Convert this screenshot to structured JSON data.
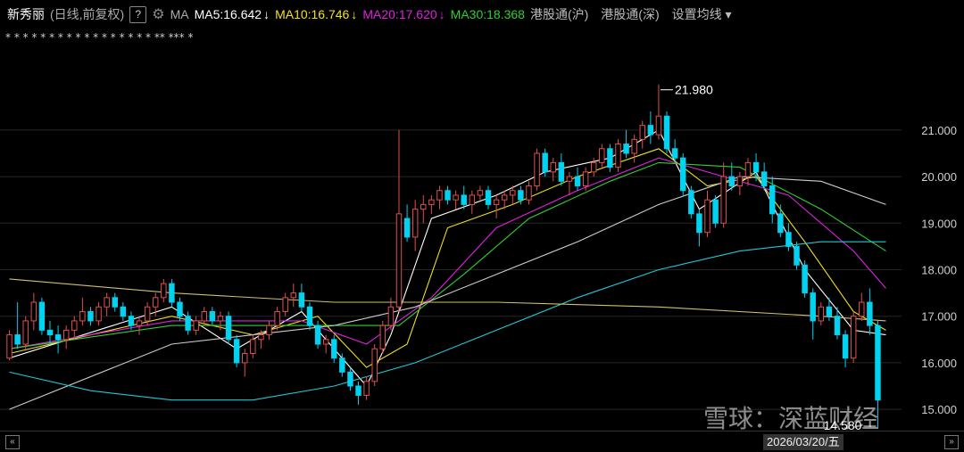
{
  "header": {
    "stock_name": "新秀丽",
    "adjust_mode": "(日线,前复权)",
    "help_label": "?",
    "ma_label": "MA",
    "ma5": "MA5:16.642",
    "ma10": "MA10:16.746",
    "ma20": "MA20:17.620",
    "ma30": "MA30:18.368",
    "hk_sh": "港股通(沪)",
    "hk_sz": "港股通(深)",
    "settings": "设置均线",
    "down_arrow": "↓",
    "settings_arrow": "▾"
  },
  "icons": {
    "gear": "gear-icon",
    "prev": "arrow-left-icon",
    "next": "arrow-right-icon",
    "watermark": "snowball-logo-icon"
  },
  "colors": {
    "up": "#e05050",
    "down": "#00d2f0",
    "ma5": "#ffffff",
    "ma10": "#f0e020",
    "ma20": "#e020e0",
    "ma30": "#30d030",
    "ma_long1": "#cccccc",
    "ma_long2": "#20c8d8",
    "ma_long3": "#d0c070"
  },
  "footer": {
    "date": "2026/03/20/五",
    "prev": "«",
    "next": "»"
  },
  "watermark": "雪球：深蓝财经",
  "chart_data": {
    "type": "candlestick",
    "ylim": [
      14.6,
      22.3
    ],
    "yticks": [
      "21.000",
      "20.000",
      "19.000",
      "18.000",
      "17.000",
      "16.000",
      "15.000"
    ],
    "high_label": "21.980",
    "low_label": "14.580",
    "marker_row": [
      "*",
      "*",
      "*",
      "*",
      "*",
      "* * *",
      "*",
      "*",
      "*",
      "*",
      "* *",
      "*",
      "*",
      "*",
      "**",
      "***",
      "*"
    ],
    "candles": [
      [
        16.1,
        16.7,
        16.05,
        16.6
      ],
      [
        16.6,
        17.3,
        16.3,
        16.4
      ],
      [
        16.4,
        17.0,
        16.3,
        16.9
      ],
      [
        16.9,
        17.5,
        16.7,
        17.3
      ],
      [
        17.3,
        17.4,
        16.6,
        16.7
      ],
      [
        16.7,
        16.9,
        16.4,
        16.6
      ],
      [
        16.6,
        16.8,
        16.2,
        16.5
      ],
      [
        16.5,
        16.8,
        16.3,
        16.7
      ],
      [
        16.7,
        17.0,
        16.5,
        16.9
      ],
      [
        16.9,
        17.4,
        16.8,
        17.1
      ],
      [
        17.1,
        17.2,
        16.8,
        16.9
      ],
      [
        16.9,
        17.3,
        16.8,
        17.2
      ],
      [
        17.2,
        17.5,
        17.0,
        17.4
      ],
      [
        17.4,
        17.5,
        17.1,
        17.2
      ],
      [
        17.2,
        17.3,
        16.9,
        17.0
      ],
      [
        17.0,
        17.1,
        16.7,
        16.8
      ],
      [
        16.8,
        17.0,
        16.6,
        16.9
      ],
      [
        16.9,
        17.3,
        16.8,
        17.2
      ],
      [
        17.2,
        17.5,
        17.0,
        17.4
      ],
      [
        17.4,
        17.8,
        17.3,
        17.7
      ],
      [
        17.7,
        17.8,
        17.2,
        17.3
      ],
      [
        17.3,
        17.4,
        16.9,
        17.0
      ],
      [
        17.0,
        17.1,
        16.6,
        16.7
      ],
      [
        16.7,
        17.0,
        16.6,
        16.9
      ],
      [
        16.9,
        17.2,
        16.8,
        17.1
      ],
      [
        17.1,
        17.2,
        16.8,
        16.9
      ],
      [
        16.9,
        17.1,
        16.7,
        17.0
      ],
      [
        17.0,
        17.1,
        16.4,
        16.5
      ],
      [
        16.5,
        16.6,
        15.9,
        16.0
      ],
      [
        16.0,
        16.3,
        15.7,
        16.2
      ],
      [
        16.2,
        16.6,
        16.1,
        16.5
      ],
      [
        16.5,
        16.7,
        16.3,
        16.6
      ],
      [
        16.6,
        16.9,
        16.5,
        16.8
      ],
      [
        16.8,
        17.2,
        16.7,
        17.1
      ],
      [
        17.1,
        17.5,
        17.0,
        17.4
      ],
      [
        17.4,
        17.7,
        17.2,
        17.5
      ],
      [
        17.5,
        17.7,
        17.1,
        17.2
      ],
      [
        17.2,
        17.3,
        16.7,
        16.8
      ],
      [
        16.8,
        16.9,
        16.3,
        16.4
      ],
      [
        16.4,
        16.6,
        16.2,
        16.5
      ],
      [
        16.5,
        16.6,
        16.0,
        16.1
      ],
      [
        16.1,
        16.2,
        15.7,
        15.8
      ],
      [
        15.8,
        15.9,
        15.4,
        15.5
      ],
      [
        15.5,
        15.6,
        15.1,
        15.3
      ],
      [
        15.3,
        15.7,
        15.2,
        15.6
      ],
      [
        15.6,
        16.4,
        15.5,
        16.3
      ],
      [
        16.3,
        16.9,
        16.2,
        16.8
      ],
      [
        16.8,
        17.4,
        16.7,
        17.2
      ],
      [
        17.2,
        21.0,
        17.1,
        19.2
      ],
      [
        19.1,
        19.4,
        18.6,
        18.7
      ],
      [
        18.7,
        19.5,
        18.4,
        19.3
      ],
      [
        19.3,
        19.6,
        19.0,
        19.4
      ],
      [
        19.4,
        19.6,
        19.2,
        19.5
      ],
      [
        19.5,
        19.8,
        19.3,
        19.7
      ],
      [
        19.7,
        19.8,
        19.4,
        19.5
      ],
      [
        19.5,
        19.7,
        19.3,
        19.6
      ],
      [
        19.6,
        19.8,
        19.3,
        19.4
      ],
      [
        19.4,
        19.7,
        19.2,
        19.6
      ],
      [
        19.6,
        19.8,
        19.5,
        19.7
      ],
      [
        19.7,
        19.8,
        19.3,
        19.4
      ],
      [
        19.4,
        19.6,
        19.1,
        19.5
      ],
      [
        19.5,
        19.7,
        19.3,
        19.6
      ],
      [
        19.6,
        19.8,
        19.4,
        19.7
      ],
      [
        19.7,
        19.8,
        19.4,
        19.5
      ],
      [
        19.5,
        19.9,
        19.4,
        19.8
      ],
      [
        19.8,
        20.6,
        19.7,
        20.5
      ],
      [
        20.5,
        20.6,
        20.0,
        20.1
      ],
      [
        20.1,
        20.4,
        19.9,
        20.3
      ],
      [
        20.3,
        20.5,
        19.8,
        19.9
      ],
      [
        19.9,
        20.1,
        19.6,
        20.0
      ],
      [
        20.0,
        20.2,
        19.7,
        19.8
      ],
      [
        19.8,
        20.2,
        19.7,
        20.1
      ],
      [
        20.1,
        20.4,
        20.0,
        20.3
      ],
      [
        20.3,
        20.7,
        20.2,
        20.6
      ],
      [
        20.6,
        20.7,
        20.1,
        20.2
      ],
      [
        20.2,
        20.8,
        20.1,
        20.7
      ],
      [
        20.7,
        21.0,
        20.4,
        20.5
      ],
      [
        20.5,
        20.9,
        20.3,
        20.8
      ],
      [
        20.8,
        21.2,
        20.6,
        21.1
      ],
      [
        21.1,
        21.4,
        20.7,
        20.9
      ],
      [
        20.9,
        21.98,
        20.8,
        21.3
      ],
      [
        21.3,
        21.4,
        20.5,
        20.6
      ],
      [
        20.6,
        20.8,
        20.3,
        20.4
      ],
      [
        20.4,
        20.5,
        19.6,
        19.7
      ],
      [
        19.7,
        19.8,
        19.1,
        19.2
      ],
      [
        19.2,
        19.3,
        18.5,
        18.8
      ],
      [
        18.8,
        19.7,
        18.7,
        19.5
      ],
      [
        19.5,
        19.6,
        18.9,
        19.0
      ],
      [
        19.0,
        20.3,
        18.9,
        20.0
      ],
      [
        20.0,
        20.3,
        19.7,
        19.8
      ],
      [
        19.8,
        20.1,
        19.6,
        20.0
      ],
      [
        20.0,
        20.4,
        19.8,
        20.3
      ],
      [
        20.3,
        20.5,
        19.9,
        20.1
      ],
      [
        20.1,
        20.3,
        19.7,
        19.8
      ],
      [
        19.8,
        20.0,
        19.0,
        19.2
      ],
      [
        19.2,
        19.4,
        18.7,
        18.8
      ],
      [
        18.8,
        19.0,
        18.4,
        18.5
      ],
      [
        18.5,
        18.6,
        18.0,
        18.1
      ],
      [
        18.1,
        18.2,
        17.4,
        17.5
      ],
      [
        17.5,
        17.6,
        16.5,
        16.9
      ],
      [
        16.9,
        17.3,
        16.8,
        17.2
      ],
      [
        17.2,
        17.4,
        16.9,
        17.0
      ],
      [
        17.0,
        17.2,
        16.5,
        16.6
      ],
      [
        16.6,
        16.7,
        15.9,
        16.1
      ],
      [
        16.1,
        17.1,
        16.0,
        17.0
      ],
      [
        17.0,
        17.5,
        16.9,
        17.3
      ],
      [
        17.3,
        17.6,
        16.6,
        16.8
      ],
      [
        16.8,
        16.9,
        14.58,
        15.2
      ]
    ],
    "ma": {
      "ma5": [
        [
          0,
          16.1
        ],
        [
          20,
          17.2
        ],
        [
          28,
          16.3
        ],
        [
          36,
          17.1
        ],
        [
          44,
          15.5
        ],
        [
          47,
          16.6
        ],
        [
          52,
          19.1
        ],
        [
          60,
          19.6
        ],
        [
          66,
          20.1
        ],
        [
          74,
          20.4
        ],
        [
          80,
          21.0
        ],
        [
          85,
          19.3
        ],
        [
          92,
          20.1
        ],
        [
          98,
          18.0
        ],
        [
          104,
          16.7
        ],
        [
          108,
          16.6
        ]
      ],
      "ma10": [
        [
          0,
          16.2
        ],
        [
          20,
          17.0
        ],
        [
          30,
          16.6
        ],
        [
          38,
          17.0
        ],
        [
          44,
          15.9
        ],
        [
          49,
          16.4
        ],
        [
          54,
          18.9
        ],
        [
          62,
          19.4
        ],
        [
          70,
          20.0
        ],
        [
          80,
          20.6
        ],
        [
          86,
          19.8
        ],
        [
          92,
          20.0
        ],
        [
          98,
          18.6
        ],
        [
          104,
          17.1
        ],
        [
          108,
          16.7
        ]
      ],
      "ma20": [
        [
          0,
          16.3
        ],
        [
          20,
          16.9
        ],
        [
          36,
          16.9
        ],
        [
          44,
          16.4
        ],
        [
          52,
          17.4
        ],
        [
          60,
          18.9
        ],
        [
          70,
          19.7
        ],
        [
          80,
          20.4
        ],
        [
          88,
          20.0
        ],
        [
          96,
          19.6
        ],
        [
          104,
          18.4
        ],
        [
          108,
          17.6
        ]
      ],
      "ma30": [
        [
          0,
          16.3
        ],
        [
          20,
          16.8
        ],
        [
          40,
          16.8
        ],
        [
          48,
          16.8
        ],
        [
          56,
          17.9
        ],
        [
          64,
          19.1
        ],
        [
          74,
          19.9
        ],
        [
          80,
          20.3
        ],
        [
          90,
          20.2
        ],
        [
          100,
          19.3
        ],
        [
          108,
          18.4
        ]
      ],
      "ma60": [
        [
          0,
          15.0
        ],
        [
          20,
          16.4
        ],
        [
          40,
          16.8
        ],
        [
          50,
          17.2
        ],
        [
          60,
          17.9
        ],
        [
          70,
          18.6
        ],
        [
          80,
          19.4
        ],
        [
          90,
          20.0
        ],
        [
          100,
          19.9
        ],
        [
          108,
          19.4
        ]
      ],
      "ma120": [
        [
          0,
          15.8
        ],
        [
          10,
          15.4
        ],
        [
          20,
          15.2
        ],
        [
          30,
          15.2
        ],
        [
          40,
          15.5
        ],
        [
          50,
          16.0
        ],
        [
          60,
          16.7
        ],
        [
          70,
          17.4
        ],
        [
          80,
          18.0
        ],
        [
          90,
          18.4
        ],
        [
          100,
          18.6
        ],
        [
          108,
          18.6
        ]
      ],
      "ma250": [
        [
          0,
          17.8
        ],
        [
          20,
          17.5
        ],
        [
          40,
          17.3
        ],
        [
          60,
          17.3
        ],
        [
          80,
          17.2
        ],
        [
          100,
          17.0
        ],
        [
          108,
          16.9
        ]
      ]
    }
  }
}
